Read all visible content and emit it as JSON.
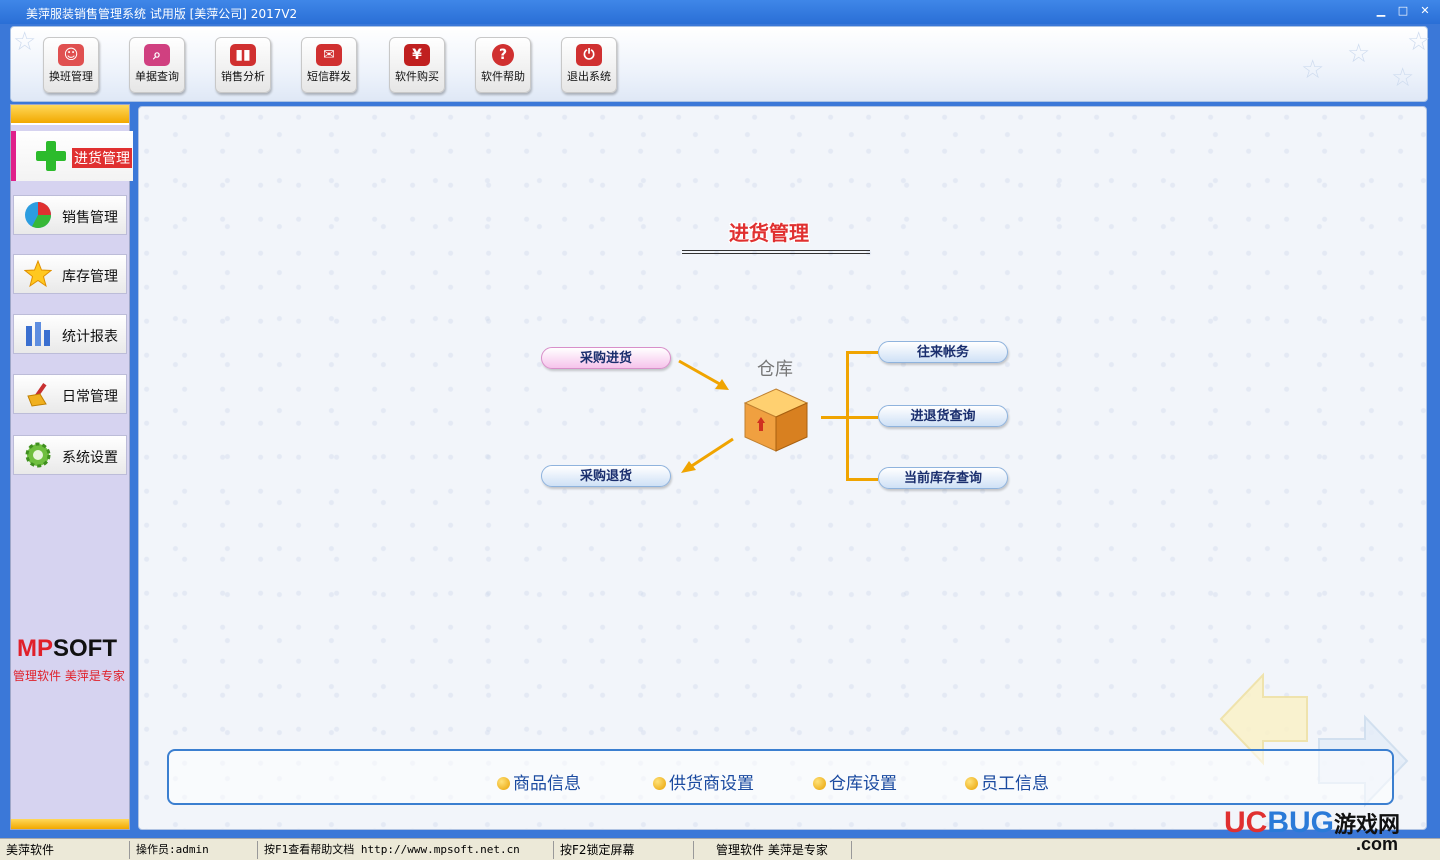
{
  "window": {
    "title": "美萍服装销售管理系统 试用版 [美萍公司] 2017V2",
    "minimize": "▁",
    "maximize": "□",
    "close": "✕"
  },
  "toolbar": {
    "items": [
      {
        "label": "换班管理",
        "icon": "user-swap-icon",
        "color": "#e05050"
      },
      {
        "label": "单据查询",
        "icon": "magnifier-icon",
        "color": "#d04080"
      },
      {
        "label": "销售分析",
        "icon": "bar-chart-icon",
        "color": "#d03030"
      },
      {
        "label": "短信群发",
        "icon": "envelope-icon",
        "color": "#d03030"
      },
      {
        "label": "软件购买",
        "icon": "yen-icon",
        "color": "#c02020"
      },
      {
        "label": "软件帮助",
        "icon": "help-icon",
        "color": "#d03030"
      },
      {
        "label": "退出系统",
        "icon": "power-icon",
        "color": "#d03030"
      }
    ]
  },
  "sidebar": {
    "active": {
      "label": "进货管理",
      "icon": "plus-icon"
    },
    "items": [
      {
        "label": "销售管理",
        "icon": "pie-chart-icon"
      },
      {
        "label": "库存管理",
        "icon": "star-icon"
      },
      {
        "label": "统计报表",
        "icon": "report-bars-icon"
      },
      {
        "label": "日常管理",
        "icon": "broom-icon"
      },
      {
        "label": "系统设置",
        "icon": "gear-icon"
      }
    ],
    "logo": {
      "mp": "MP",
      "soft": "SOFT",
      "tagline": "管理软件  美萍是专家"
    }
  },
  "main": {
    "title": "进货管理",
    "warehouse_label": "仓库",
    "left_buttons": {
      "purchase_in": "采购进货",
      "purchase_return": "采购退货"
    },
    "right_buttons": {
      "accounts": "往来帐务",
      "in_return_query": "进退货查询",
      "current_stock_query": "当前库存查询"
    },
    "bottom_links": [
      "商品信息",
      "供货商设置",
      "仓库设置",
      "员工信息"
    ],
    "accent_color": "#f0a400"
  },
  "statusbar": {
    "app": "美萍软件",
    "operator": "操作员:admin",
    "help": "按F1查看帮助文档  http://www.mpsoft.net.cn",
    "lock": "按F2锁定屏幕",
    "slogan": "管理软件 美萍是专家"
  },
  "watermark": {
    "uc": "UC",
    "bug": "BUG",
    "cn": "游戏网",
    "com": ".com"
  }
}
